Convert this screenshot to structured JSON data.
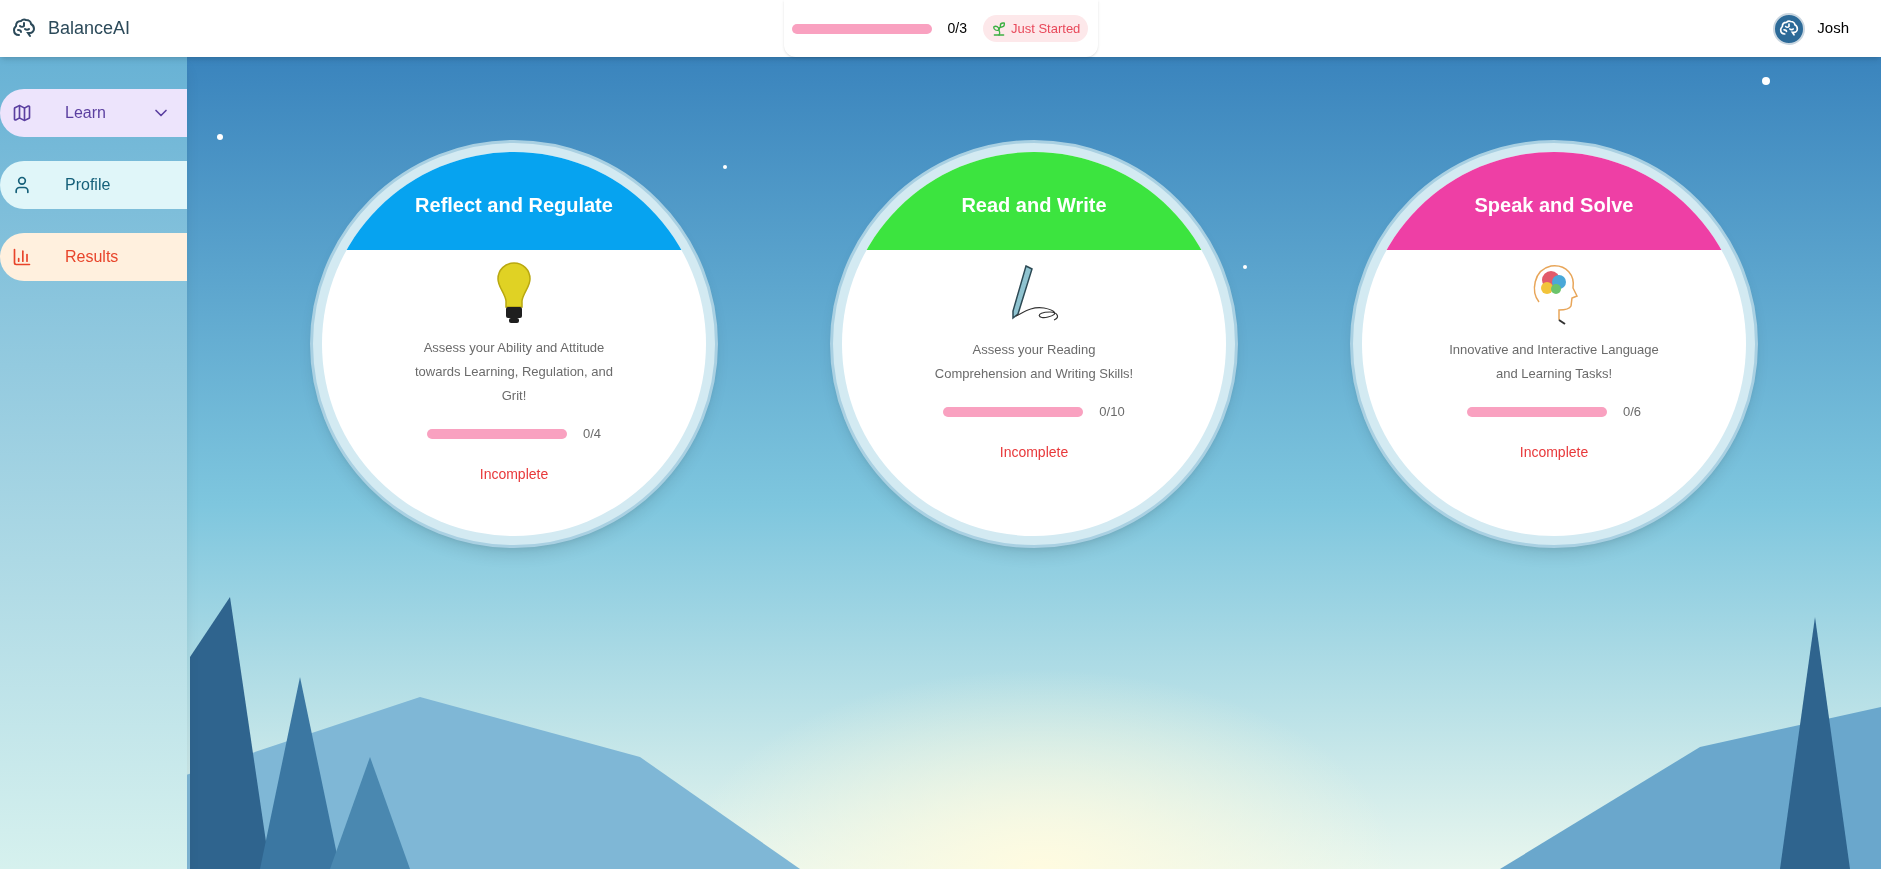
{
  "app": {
    "name": "BalanceAI"
  },
  "overall_progress": {
    "level": 0,
    "reading": "0/3",
    "status": "Just Started"
  },
  "user": {
    "name": "Josh"
  },
  "sidebar": {
    "items": [
      {
        "label": "Learn",
        "kind": "map",
        "color": "#5b3fa0",
        "expanded": false
      },
      {
        "label": "Profile",
        "kind": "person",
        "color": "#15607a"
      },
      {
        "label": "Results",
        "kind": "chart",
        "color": "#e8442a"
      }
    ]
  },
  "modules": [
    {
      "title": "Reflect and Regulate",
      "kind": "bulb",
      "color": "#06a3f0",
      "description": "Assess your Ability and Attitude towards Learning, Regulation, and Grit!",
      "level": 0,
      "reading": "0/4",
      "status": "Incomplete"
    },
    {
      "title": "Read and Write",
      "kind": "pen",
      "color": "#3ce43f",
      "description": "Assess your Reading Comprehension and Writing Skills!",
      "level": 0,
      "reading": "0/10",
      "status": "Incomplete"
    },
    {
      "title": "Speak and Solve",
      "kind": "brain",
      "color": "#ee3fa5",
      "description": "Innovative and Interactive Language and Learning Tasks!",
      "level": 0,
      "reading": "0/6",
      "status": "Incomplete"
    }
  ]
}
